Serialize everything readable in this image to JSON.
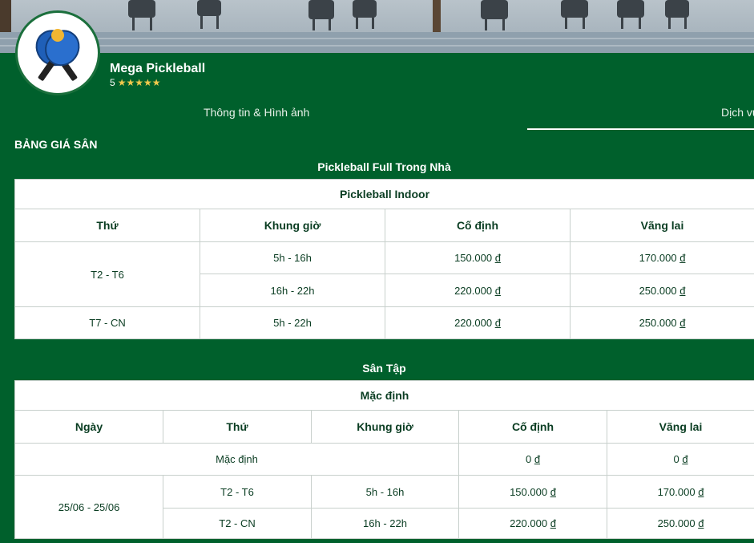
{
  "venue": {
    "name": "Mega Pickleball",
    "rating": "5",
    "stars": "★★★★★"
  },
  "tabs": [
    {
      "label": "Thông tin & Hình ảnh"
    },
    {
      "label": "Dịch vụ"
    }
  ],
  "section_title": "BẢNG GIÁ SÂN",
  "currency": "đ",
  "groups": [
    {
      "title": "Pickleball Full Trong Nhà",
      "caption": "Pickleball Indoor",
      "headers": [
        "Thứ",
        "Khung giờ",
        "Cố định",
        "Vãng lai"
      ],
      "rows": [
        {
          "day": "T2 - T6",
          "slot": "5h - 16h",
          "fixed": "150.000",
          "walkin": "170.000"
        },
        {
          "slot": "16h - 22h",
          "fixed": "220.000",
          "walkin": "250.000"
        },
        {
          "day": "T7 - CN",
          "slot": "5h - 22h",
          "fixed": "220.000",
          "walkin": "250.000"
        }
      ]
    },
    {
      "title": "Sân Tập",
      "caption": "Mặc định",
      "headers": [
        "Ngày",
        "Thứ",
        "Khung giờ",
        "Cố định",
        "Vãng lai"
      ],
      "default_row": {
        "label": "Mặc định",
        "fixed": "0",
        "walkin": "0"
      },
      "rows": [
        {
          "date": "25/06 - 25/06",
          "day": "T2 - T6",
          "slot": "5h - 16h",
          "fixed": "150.000",
          "walkin": "170.000"
        },
        {
          "day": "T2 - CN",
          "slot": "16h - 22h",
          "fixed": "220.000",
          "walkin": "250.000"
        }
      ]
    }
  ],
  "colors": {
    "background": "#00602c",
    "table_text": "#0a3d22",
    "star": "#f2c94c",
    "logo_paddle": "#1f5fb8",
    "logo_ball": "#f2b632"
  }
}
